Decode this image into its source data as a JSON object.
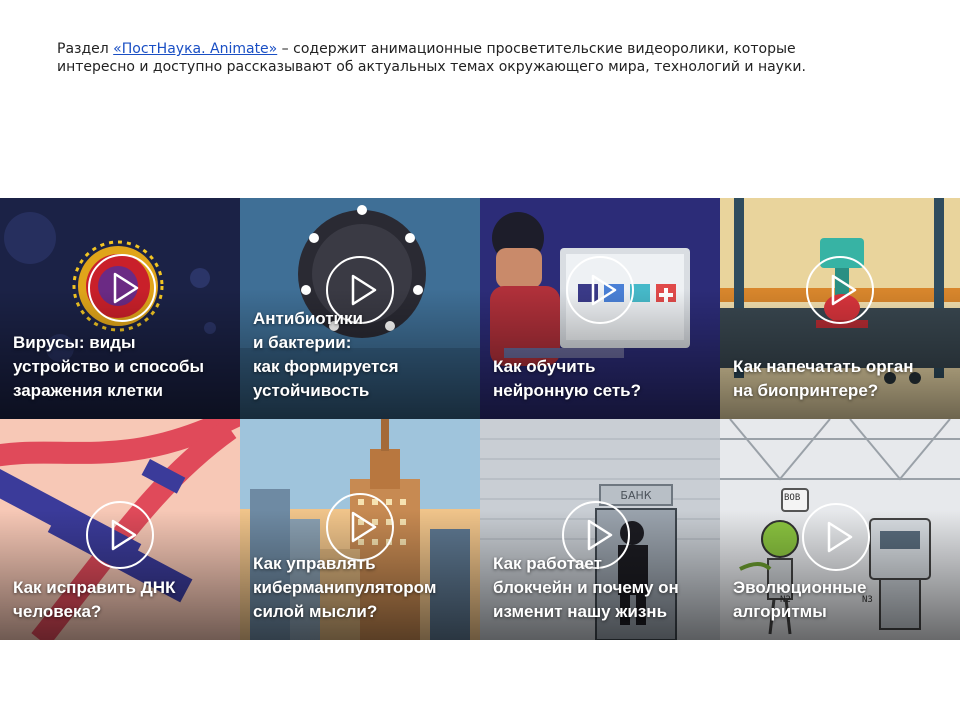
{
  "intro": {
    "prefix": "Раздел ",
    "link": "«ПостНаука. Animate»",
    "rest": " – содержит анимационные просветительские видеоролики, которые",
    "line2": "интересно и доступно рассказывают об актуальных темах окружающего мира, технологий и науки."
  },
  "videos": [
    {
      "lines": [
        "Вирусы: виды",
        "устройство и способы",
        "заражения клетки"
      ]
    },
    {
      "lines": [
        "Антибиотики",
        "и бактерии:",
        "как формируется",
        "устойчивость"
      ]
    },
    {
      "lines": [
        "Как обучить",
        "нейронную сеть?"
      ]
    },
    {
      "lines": [
        "Как напечатать орган",
        "на биопринтере?"
      ]
    },
    {
      "lines": [
        "Как исправить ДНК",
        "человека?"
      ]
    },
    {
      "lines": [
        "Как управлять",
        "киберманипулятором",
        "силой мысли?"
      ]
    },
    {
      "lines": [
        "Как работает",
        "блокчейн и почему он",
        "изменит нашу жизнь"
      ]
    },
    {
      "lines": [
        "Эволюционные",
        "алгоритмы"
      ]
    }
  ],
  "decor": {
    "bank_sign": "БАНК",
    "robot_sign": "BOB",
    "badge_n2": "N2",
    "badge_n3": "N3"
  }
}
